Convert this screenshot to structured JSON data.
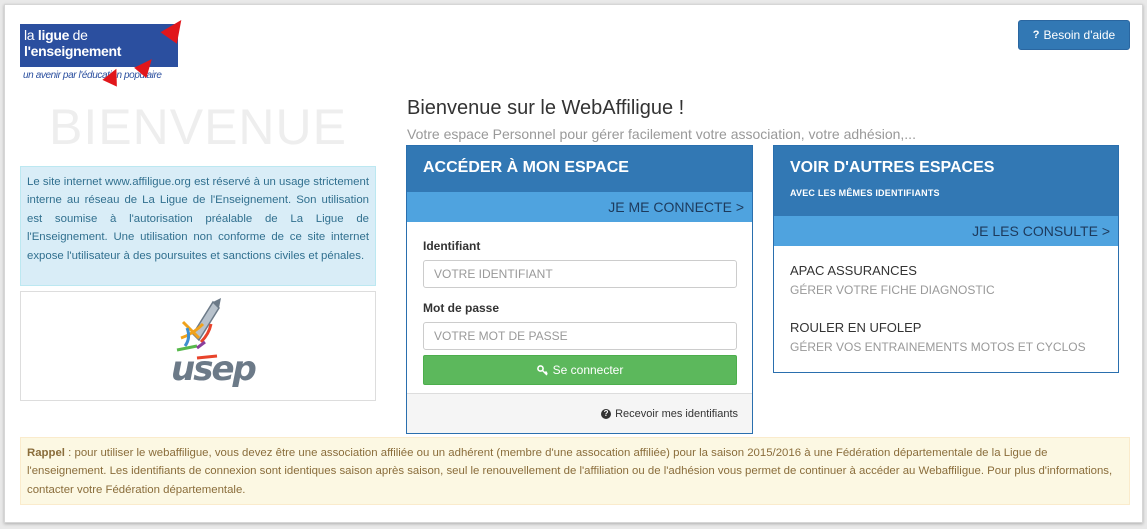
{
  "logo": {
    "line1_prefix": "la",
    "line1_bold": "ligue",
    "line1_suffix": "de",
    "line2": "l'enseignement",
    "tagline": "un avenir par l'éducation populaire"
  },
  "help_button": {
    "label": "Besoin d'aide",
    "icon": "question-icon"
  },
  "bienvenue": "BIENVENUE",
  "info_text": "Le site internet www.affiligue.org est réservé à un usage strictement interne au réseau de La Ligue de l'Enseignement. Son utilisation est soumise à l'autorisation préalable de La Ligue de l'Enseignement. Une utilisation non conforme de ce site internet expose l'utilisateur à des poursuites et sanctions civiles et pénales.",
  "usep_logo": {
    "text": "usep"
  },
  "welcome": {
    "title": "Bienvenue sur le WebAffiligue !",
    "subtitle": "Votre espace Personnel pour gérer facilement votre association, votre adhésion,..."
  },
  "login_panel": {
    "title": "ACCÉDER À MON ESPACE",
    "link": "JE ME CONNECTE >",
    "id_label": "Identifiant",
    "id_placeholder": "VOTRE IDENTIFIANT",
    "pwd_label": "Mot de passe",
    "pwd_placeholder": "VOTRE MOT DE PASSE",
    "connect_label": "Se connecter",
    "connect_icon": "key-icon",
    "forgot_label": "Recevoir mes identifiants"
  },
  "other_panel": {
    "title": "VOIR D'AUTRES ESPACES",
    "subtitle": "AVEC LES MÊMES IDENTIFIANTS",
    "link": "JE LES CONSULTE >",
    "items": [
      {
        "name": "APAC ASSURANCES",
        "desc": "GÉRER VOTRE FICHE DIAGNOSTIC"
      },
      {
        "name": "ROULER EN UFOLEP",
        "desc": "GÉRER VOS ENTRAINEMENTS MOTOS ET CYCLOS"
      }
    ]
  },
  "rappel": {
    "label": "Rappel",
    "text": " : pour utiliser le webaffiligue, vous devez être une association affiliée ou un adhérent (membre d'une assocation affiliée) pour la saison 2015/2016 à une Fédération départementale de la Ligue de l'enseignement. Les identifiants de connexion sont identiques saison après saison, seul le renouvellement de l'affiliation ou de l'adhésion vous permet de continuer à accéder au Webaffiligue. Pour plus d'informations, contacter votre Fédération départementale."
  },
  "colors": {
    "primary": "#3278b4",
    "link_bar": "#4fa3df",
    "success": "#5cb85c",
    "info_bg": "#d9edf7",
    "warning_bg": "#fcf8e3",
    "logo_blue": "#2b4f9f",
    "logo_red": "#e1161b"
  }
}
